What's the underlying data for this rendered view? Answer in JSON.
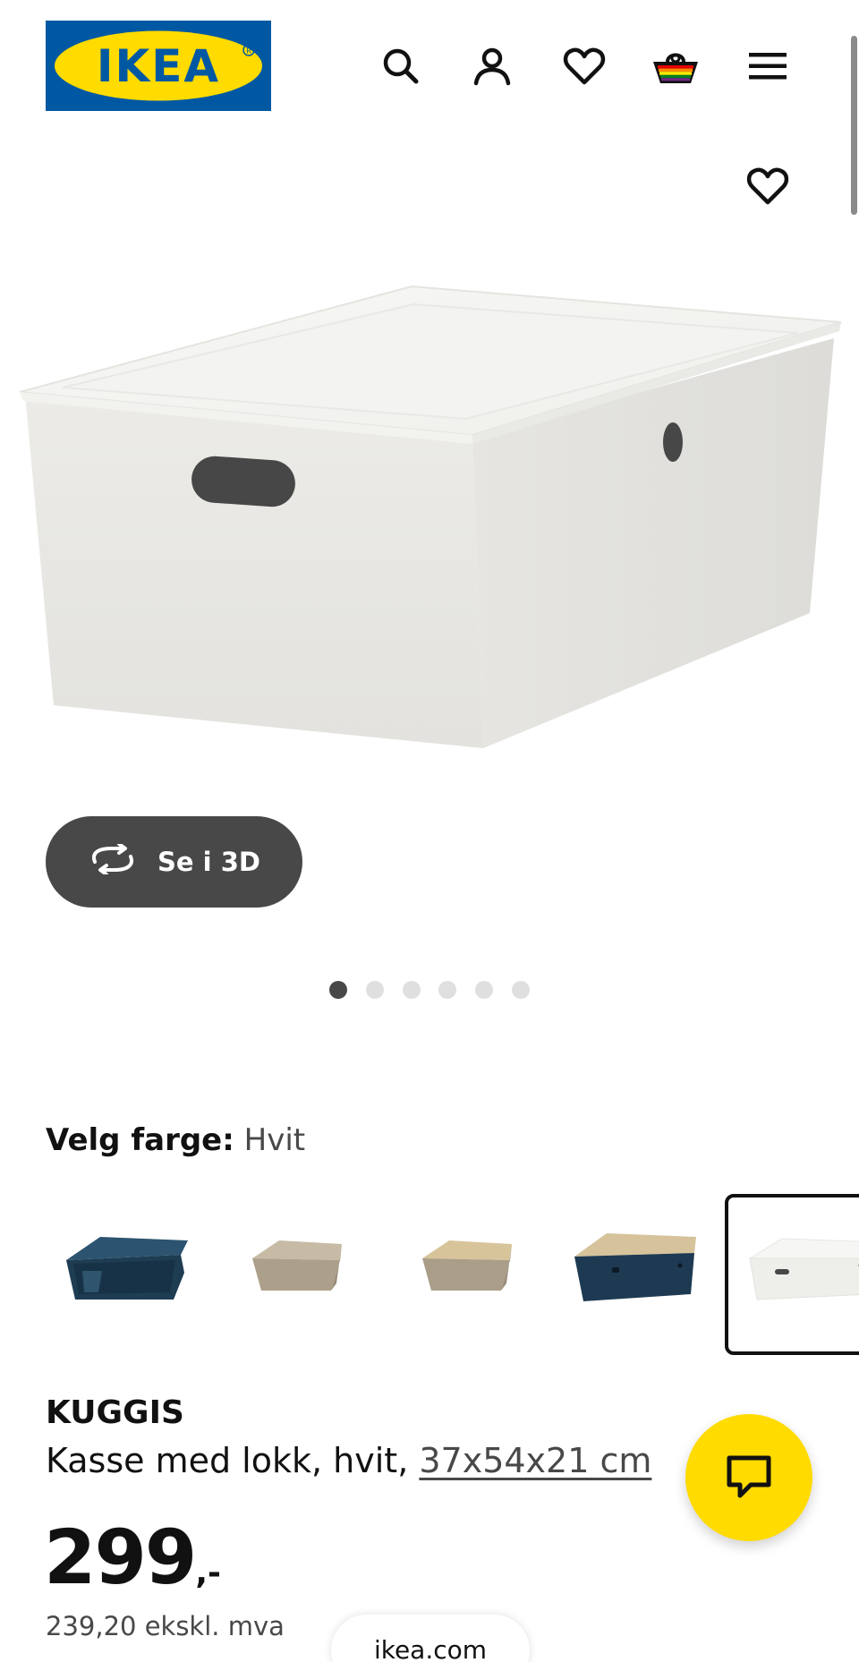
{
  "header": {
    "logo_text": "IKEA",
    "icons": [
      "search-icon",
      "account-icon",
      "heart-icon",
      "shopping-bag-icon",
      "menu-icon"
    ]
  },
  "product": {
    "favorite_icon": "heart-icon",
    "view_3d_label": "Se i 3D",
    "gallery": {
      "count": 6,
      "active_index": 0
    },
    "color": {
      "label": "Velg farge:",
      "value": "Hvit",
      "swatches": [
        {
          "name": "dark-blue-box",
          "color": "#1f3f55"
        },
        {
          "name": "beige-box",
          "color": "#b1a38d"
        },
        {
          "name": "bamboo-lid-beige-box",
          "color": "#a59a85"
        },
        {
          "name": "bamboo-lid-dark-blue-box",
          "color": "#223b53"
        },
        {
          "name": "white-box",
          "color": "#f0f0ee",
          "selected": true
        }
      ]
    },
    "name": "KUGGIS",
    "description_prefix": "Kasse med lokk, hvit, ",
    "dimensions": "37x54x21 cm",
    "price_integer": "299",
    "price_suffix": ",-",
    "price_ex_vat": "239,20 ekskl. mva"
  },
  "chat": {
    "icon": "chat-icon"
  },
  "browser": {
    "url": "ikea.com"
  },
  "colors": {
    "ikea_blue": "#0058a3",
    "ikea_yellow": "#ffdb00",
    "dark_button": "#484848"
  }
}
